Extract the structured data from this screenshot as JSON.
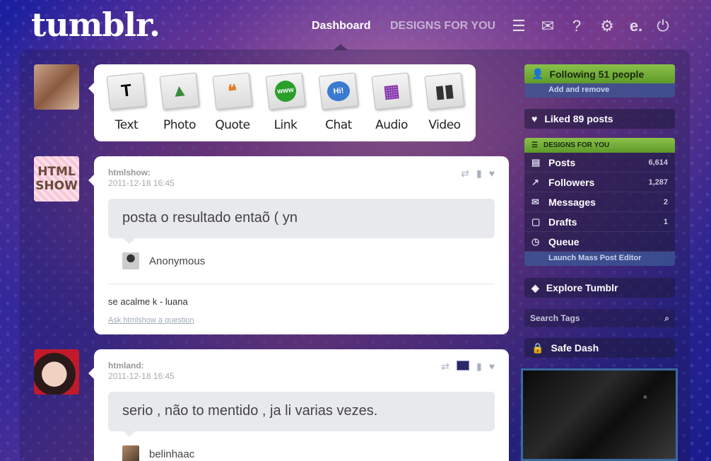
{
  "header": {
    "logo": "tumblr.",
    "nav": {
      "dashboard": "Dashboard",
      "designs": "DESIGNS FOR YOU"
    },
    "icons": [
      "list-icon",
      "mail-icon",
      "help-icon",
      "gear-icon",
      "e-icon",
      "power-icon"
    ]
  },
  "composer": {
    "types": [
      {
        "label": "Text",
        "glyph": "T",
        "color": "#222222"
      },
      {
        "label": "Photo",
        "glyph": "▲",
        "color": "#3a8a3a"
      },
      {
        "label": "Quote",
        "glyph": "❝",
        "color": "#e0802a"
      },
      {
        "label": "Link",
        "glyph": "www",
        "color": "#2aa02a"
      },
      {
        "label": "Chat",
        "glyph": "Hi!",
        "color": "#3a7ad0"
      },
      {
        "label": "Audio",
        "glyph": "▦",
        "color": "#8a3ab0"
      },
      {
        "label": "Video",
        "glyph": "▮▮",
        "color": "#333333"
      }
    ]
  },
  "posts": [
    {
      "user": "htmlshow:",
      "date": "2011-12-18 16:45",
      "question": "posta o resultado entaõ ( yn",
      "asker": "Anonymous",
      "answer": "se acalme k - luana",
      "ask_link": "Ask htmlshow a question"
    },
    {
      "user": "htmland:",
      "date": "2011-12-18 16:45",
      "question": "serio , não to mentido , ja li varias vezes.",
      "asker": "belinhaac"
    }
  ],
  "avatar_text": "HTML SHOW",
  "sidebar": {
    "following": "Following 51 people",
    "add_remove": "Add and remove",
    "liked": "Liked 89 posts",
    "designs_header": "DESIGNS FOR YOU",
    "stats": [
      {
        "label": "Posts",
        "count": "6,614",
        "icon": "doc-icon"
      },
      {
        "label": "Followers",
        "count": "1,287",
        "icon": "chart-icon"
      },
      {
        "label": "Messages",
        "count": "2",
        "icon": "mail-icon"
      },
      {
        "label": "Drafts",
        "count": "1",
        "icon": "draft-icon"
      },
      {
        "label": "Queue",
        "count": "",
        "icon": "clock-icon"
      }
    ],
    "mass_editor": "Launch Mass Post Editor",
    "explore": "Explore Tumblr",
    "search_tags": "Search Tags",
    "safe_dash": "Safe Dash"
  },
  "colors": {
    "accent_green": "#8bc14a",
    "background_blue": "#1a1fa0"
  }
}
